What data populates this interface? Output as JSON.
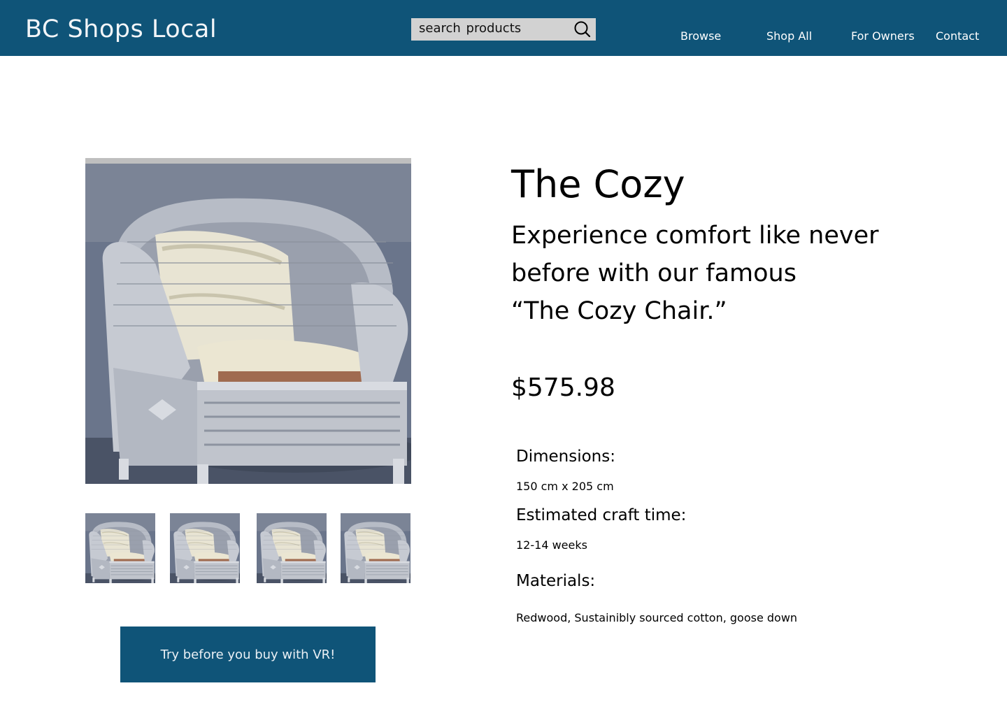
{
  "header": {
    "brand": "BC Shops Local",
    "search_placeholder": "search  products",
    "nav": [
      {
        "label": "Browse"
      },
      {
        "label": "Shop All"
      },
      {
        "label": "For Owners"
      },
      {
        "label": "Contact"
      }
    ]
  },
  "product": {
    "title": "The Cozy",
    "tagline_lines": [
      "Experience comfort like never",
      "before with our famous",
      "“The Cozy Chair.”"
    ],
    "price": "$575.98",
    "specs": [
      {
        "heading": "Dimensions:",
        "value": "150 cm x 205 cm"
      },
      {
        "heading": "Estimated  craft time:",
        "value": "12-14 weeks"
      },
      {
        "heading": "Materials:",
        "value": "Redwood, Sustainibly sourced cotton, goose down"
      }
    ]
  },
  "gallery": {
    "thumbnail_count": 4
  },
  "cta_label": "Try before you buy with VR!",
  "colors": {
    "header_bg": "#0f5478",
    "button_bg": "#0f5478",
    "search_bg": "#d2d2d2"
  },
  "icons": {
    "search": "search-icon"
  }
}
